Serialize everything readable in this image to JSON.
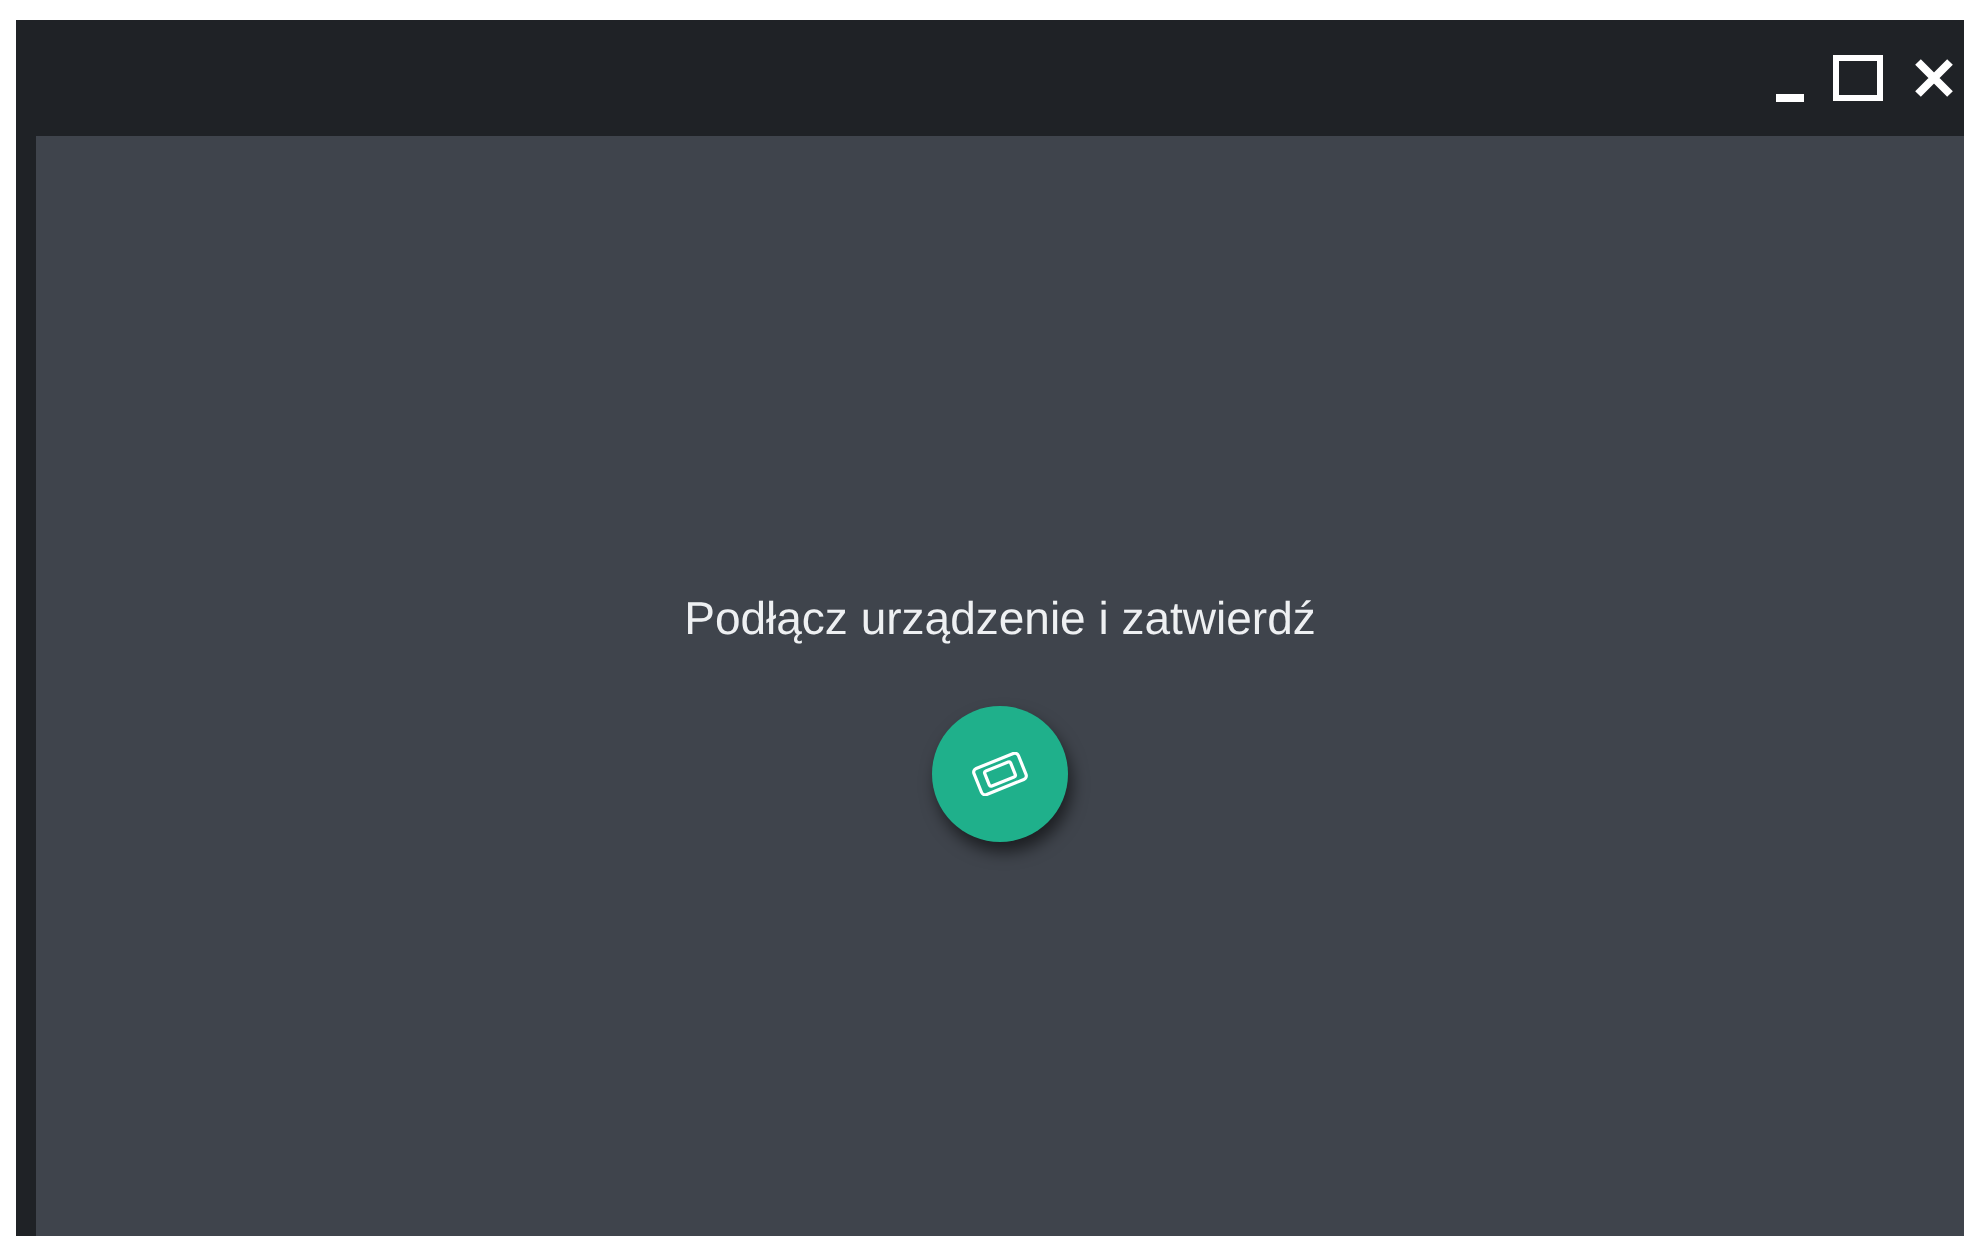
{
  "message": "Podłącz urządzenie i zatwierdź"
}
